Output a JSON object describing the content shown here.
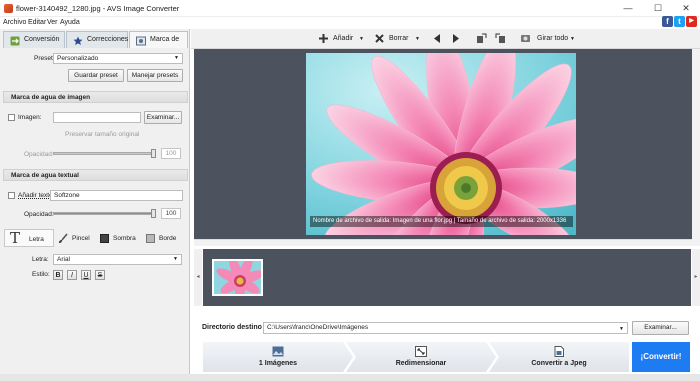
{
  "window": {
    "title": "flower-3140492_1280.jpg - AVS Image Converter",
    "minimize_glyph": "—",
    "maximize_glyph": "☐",
    "close_glyph": "✕"
  },
  "menu": [
    "Archivo",
    "Editar",
    "Ver",
    "Ayuda"
  ],
  "social": {
    "facebook": "f",
    "twitter": "t",
    "youtube": "▶"
  },
  "tabs": [
    {
      "label": "Conversión",
      "icon": "conversion-icon",
      "active": false
    },
    {
      "label": "Correcciones",
      "icon": "star-icon",
      "active": false
    },
    {
      "label": "Marca de agua",
      "icon": "watermark-icon",
      "active": true
    }
  ],
  "preset": {
    "label": "Preset:",
    "value": "Personalizado",
    "save_button": "Guardar preset",
    "manage_button": "Manejar presets"
  },
  "image_watermark": {
    "header": "Marca de agua de imagen",
    "image_label": "Imagen:",
    "browse_button": "Examinar...",
    "preserve_label": "Preservar tamaño original",
    "opacity_label": "Opacidad:",
    "opacity_value": "100"
  },
  "text_watermark": {
    "header": "Marca de agua textual",
    "add_text_label": "Añadir texto",
    "text_value": "Softzone",
    "opacity_label": "Opacidad:",
    "opacity_value": "100",
    "tabs": [
      "Letra",
      "Pincel",
      "Sombra",
      "Borde"
    ],
    "font_label": "Letra:",
    "font_value": "Arial",
    "style_label": "Estilo:",
    "style_buttons": [
      "B",
      "I",
      "U",
      "S"
    ]
  },
  "toolbar": {
    "add": "Añadir",
    "delete": "Borrar",
    "rotate_all": "Girar todo"
  },
  "preview": {
    "caption": "Nombre de archivo de salida: Imagen de una flor.jpg | Tamaño de archivo de salida: 2000x1336"
  },
  "output": {
    "dest_label": "Directorio destino",
    "dest_value": "C:\\Users\\franc\\OneDrive\\Imágenes",
    "browse_button": "Examinar..."
  },
  "steps": [
    "1 Imágenes",
    "Redimensionar",
    "Convertir a Jpeg"
  ],
  "convert_button": "¡Convertir!",
  "colors": {
    "accent": "#1d7cf2",
    "preview_bg": "#4d535e",
    "panel_bg": "#f0f0f0"
  }
}
